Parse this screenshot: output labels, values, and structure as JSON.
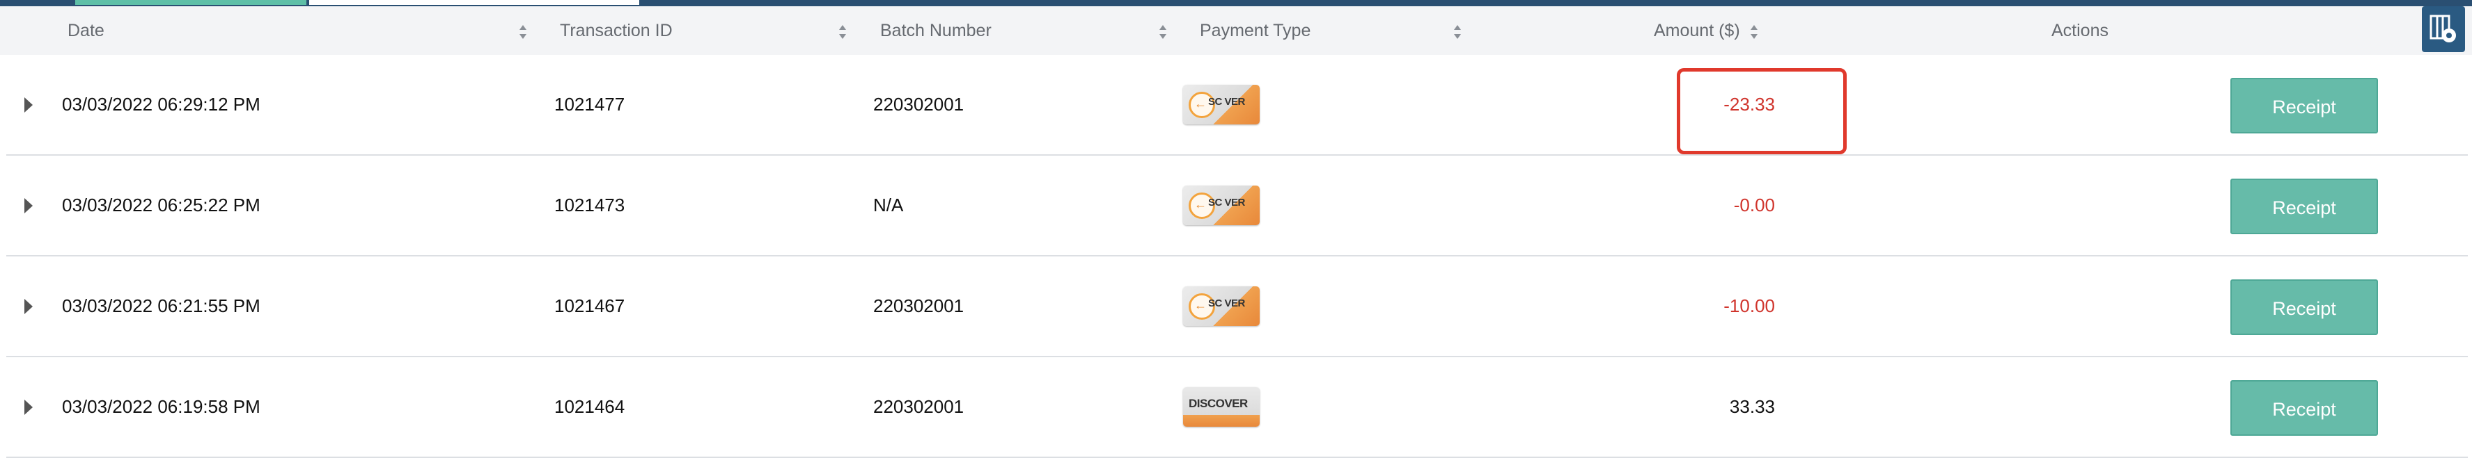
{
  "columns": {
    "date": "Date",
    "transaction_id": "Transaction ID",
    "batch_number": "Batch Number",
    "payment_type": "Payment Type",
    "amount": "Amount ($)",
    "actions": "Actions"
  },
  "column_config_icon": "table-settings-icon",
  "rows": [
    {
      "date": "03/03/2022 06:29:12 PM",
      "transaction_id": "1021477",
      "batch_number": "220302001",
      "card_text": "SC VER",
      "amount": "-23.33",
      "receipt_label": "Receipt"
    },
    {
      "date": "03/03/2022 06:25:22 PM",
      "transaction_id": "1021473",
      "batch_number": "N/A",
      "card_text": "SC VER",
      "amount": "-0.00",
      "receipt_label": "Receipt"
    },
    {
      "date": "03/03/2022 06:21:55 PM",
      "transaction_id": "1021467",
      "batch_number": "220302001",
      "card_text": "SC VER",
      "amount": "-10.00",
      "receipt_label": "Receipt"
    },
    {
      "date": "03/03/2022 06:19:58 PM",
      "transaction_id": "1021464",
      "batch_number": "220302001",
      "card_text": "DISCOVER",
      "amount": "33.33",
      "receipt_label": "Receipt"
    }
  ],
  "colors": {
    "header_bar": "#2a4f72",
    "accent": "#66bba9",
    "negative": "#d0342c",
    "highlight": "#e0392c"
  }
}
